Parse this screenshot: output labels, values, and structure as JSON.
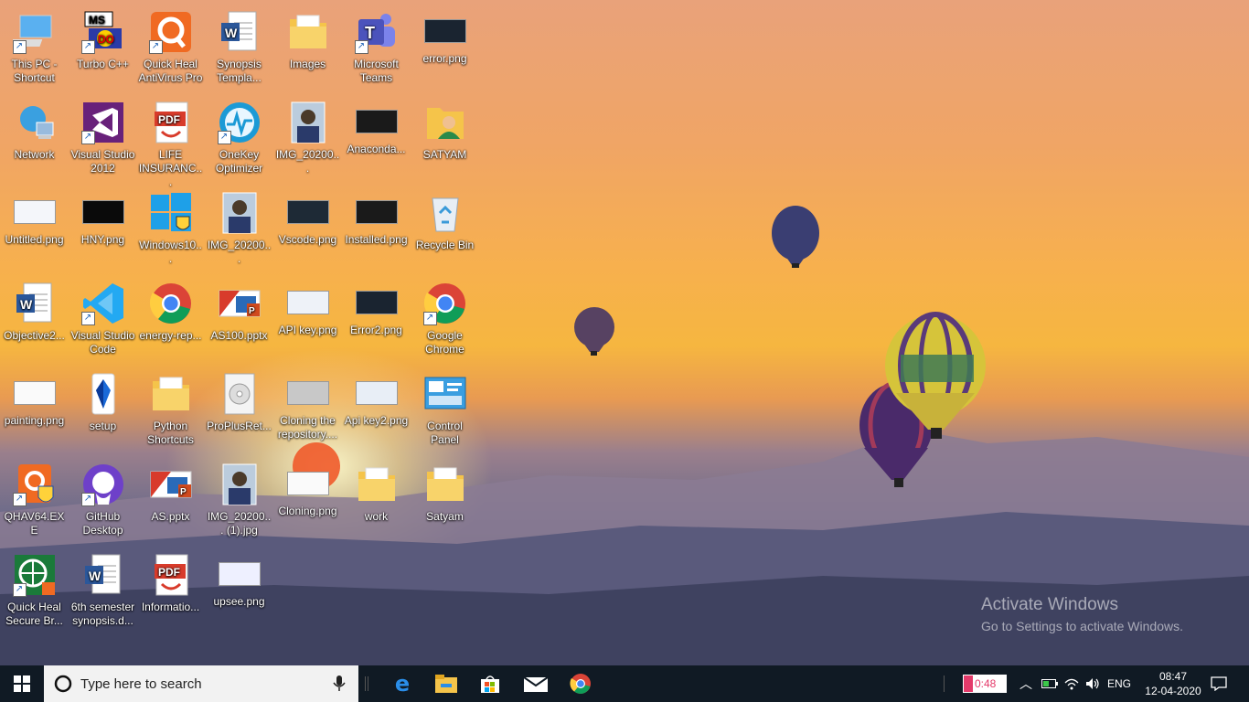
{
  "desktop": {
    "icons": [
      {
        "label": "This PC - Shortcut",
        "icon": "computer-icon"
      },
      {
        "label": "Turbo C++",
        "icon": "turbo-cpp-icon"
      },
      {
        "label": "Quick Heal AntiVirus Pro",
        "icon": "quick-heal-icon"
      },
      {
        "label": "Synopsis Templa...",
        "icon": "word-doc-icon"
      },
      {
        "label": "Images",
        "icon": "folder-icon"
      },
      {
        "label": "Microsoft Teams",
        "icon": "teams-icon"
      },
      {
        "label": "error.png",
        "icon": "image-file-icon"
      },
      {
        "label": "Network",
        "icon": "network-icon"
      },
      {
        "label": "Visual Studio 2012",
        "icon": "visual-studio-icon"
      },
      {
        "label": "LIFE INSURANC...",
        "icon": "pdf-icon"
      },
      {
        "label": "OneKey Optimizer",
        "icon": "onekey-icon"
      },
      {
        "label": "IMG_20200...",
        "icon": "photo-icon"
      },
      {
        "label": "Anaconda...",
        "icon": "image-file-icon"
      },
      {
        "label": "SATYAM",
        "icon": "user-folder-icon"
      },
      {
        "label": "Untitled.png",
        "icon": "image-file-icon"
      },
      {
        "label": "HNY.png",
        "icon": "image-file-icon"
      },
      {
        "label": "Windows10...",
        "icon": "windows-installer-icon"
      },
      {
        "label": "IMG_20200...",
        "icon": "photo-icon"
      },
      {
        "label": "Vscode.png",
        "icon": "image-file-icon"
      },
      {
        "label": "Installed.png",
        "icon": "image-file-icon"
      },
      {
        "label": "Recycle Bin",
        "icon": "recycle-bin-icon"
      },
      {
        "label": "Objective2...",
        "icon": "word-doc-icon"
      },
      {
        "label": "Visual Studio Code",
        "icon": "vscode-icon"
      },
      {
        "label": "energy-rep...",
        "icon": "chrome-icon"
      },
      {
        "label": "AS100.pptx",
        "icon": "powerpoint-icon"
      },
      {
        "label": "API key.png",
        "icon": "image-file-icon"
      },
      {
        "label": "Error2.png",
        "icon": "image-file-icon"
      },
      {
        "label": "Google Chrome",
        "icon": "chrome-icon"
      },
      {
        "label": "painting.png",
        "icon": "image-file-icon"
      },
      {
        "label": "setup",
        "icon": "setup-icon"
      },
      {
        "label": "Python Shortcuts",
        "icon": "folder-icon"
      },
      {
        "label": "ProPlusRet...",
        "icon": "disc-image-icon"
      },
      {
        "label": "Cloning the repository....",
        "icon": "image-file-icon"
      },
      {
        "label": "Api key2.png",
        "icon": "image-file-icon"
      },
      {
        "label": "Control Panel",
        "icon": "control-panel-icon"
      },
      {
        "label": "QHAV64.EXE",
        "icon": "quick-heal-installer-icon"
      },
      {
        "label": "GitHub Desktop",
        "icon": "github-icon"
      },
      {
        "label": "AS.pptx",
        "icon": "powerpoint-icon"
      },
      {
        "label": "IMG_20200... (1).jpg",
        "icon": "photo-icon"
      },
      {
        "label": "Cloning.png",
        "icon": "image-file-icon"
      },
      {
        "label": "work",
        "icon": "folder-icon"
      },
      {
        "label": "Satyam",
        "icon": "folder-icon"
      },
      {
        "label": "Quick Heal Secure Br...",
        "icon": "quick-heal-browser-icon"
      },
      {
        "label": "6th semester synopsis.d...",
        "icon": "word-doc-icon"
      },
      {
        "label": "Informatio...",
        "icon": "pdf-icon"
      },
      {
        "label": "upsee.png",
        "icon": "image-file-icon"
      }
    ],
    "watermark": {
      "title": "Activate Windows",
      "subtitle": "Go to Settings to activate Windows."
    }
  },
  "taskbar": {
    "search_placeholder": "Type here to search",
    "apps": [
      "edge-icon",
      "file-explorer-icon",
      "store-icon",
      "mail-icon",
      "chrome-icon"
    ],
    "battery_text": "0:48",
    "language": "ENG",
    "time": "08:47",
    "date": "12-04-2020"
  }
}
